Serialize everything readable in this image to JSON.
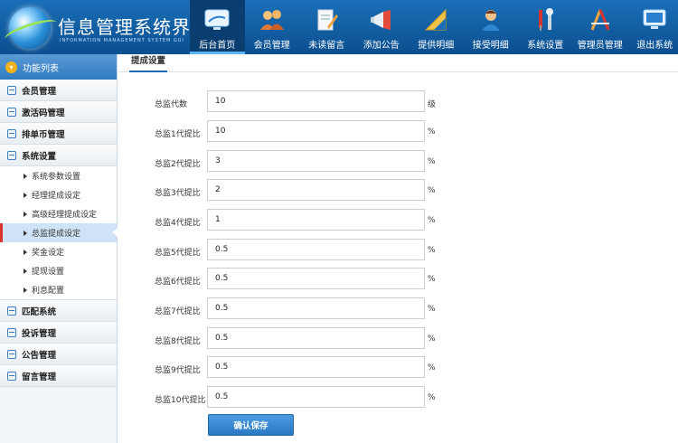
{
  "header": {
    "title": "信息管理系统界面",
    "subtitle": "INFORMATION MANAGEMENT SYSTEM GUI",
    "nav": [
      {
        "label": "后台首页",
        "icon": "home-monitor-icon",
        "active": true
      },
      {
        "label": "会员管理",
        "icon": "users-icon",
        "active": false
      },
      {
        "label": "未读留言",
        "icon": "edit-document-icon",
        "active": false
      },
      {
        "label": "添加公告",
        "icon": "megaphone-icon",
        "active": false
      },
      {
        "label": "提供明细",
        "icon": "ruler-triangle-icon",
        "active": false
      },
      {
        "label": "接受明细",
        "icon": "person-icon",
        "active": false
      },
      {
        "label": "系统设置",
        "icon": "tools-icon",
        "active": false
      },
      {
        "label": "管理员管理",
        "icon": "compass-tools-icon",
        "active": false
      },
      {
        "label": "退出系统",
        "icon": "monitor-exit-icon",
        "active": false
      }
    ]
  },
  "sidebar": {
    "header": "功能列表",
    "sections": [
      {
        "label": "会员管理",
        "items": []
      },
      {
        "label": "激活码管理",
        "items": []
      },
      {
        "label": "排单币管理",
        "items": []
      },
      {
        "label": "系统设置",
        "items": [
          {
            "label": "系统参数设置",
            "active": false
          },
          {
            "label": "经理提成设定",
            "active": false
          },
          {
            "label": "高级经理提成设定",
            "active": false
          },
          {
            "label": "总监提成设定",
            "active": true
          },
          {
            "label": "奖金设定",
            "active": false
          },
          {
            "label": "提现设置",
            "active": false
          },
          {
            "label": "利息配置",
            "active": false
          }
        ]
      },
      {
        "label": "匹配系统",
        "items": []
      },
      {
        "label": "投诉管理",
        "items": []
      },
      {
        "label": "公告管理",
        "items": []
      },
      {
        "label": "留言管理",
        "items": []
      }
    ]
  },
  "main": {
    "tab": "提成设置",
    "fields": [
      {
        "label": "总监代数",
        "value": "10",
        "unit": "级"
      },
      {
        "label": "总监1代提比",
        "value": "10",
        "unit": "%"
      },
      {
        "label": "总监2代提比",
        "value": "3",
        "unit": "%"
      },
      {
        "label": "总监3代提比",
        "value": "2",
        "unit": "%"
      },
      {
        "label": "总监4代提比",
        "value": "1",
        "unit": "%"
      },
      {
        "label": "总监5代提比",
        "value": "0.5",
        "unit": "%"
      },
      {
        "label": "总监6代提比",
        "value": "0.5",
        "unit": "%"
      },
      {
        "label": "总监7代提比",
        "value": "0.5",
        "unit": "%"
      },
      {
        "label": "总监8代提比",
        "value": "0.5",
        "unit": "%"
      },
      {
        "label": "总监9代提比",
        "value": "0.5",
        "unit": "%"
      },
      {
        "label": "总监10代提比",
        "value": "0.5",
        "unit": "%"
      }
    ],
    "submit_label": "确认保存"
  }
}
